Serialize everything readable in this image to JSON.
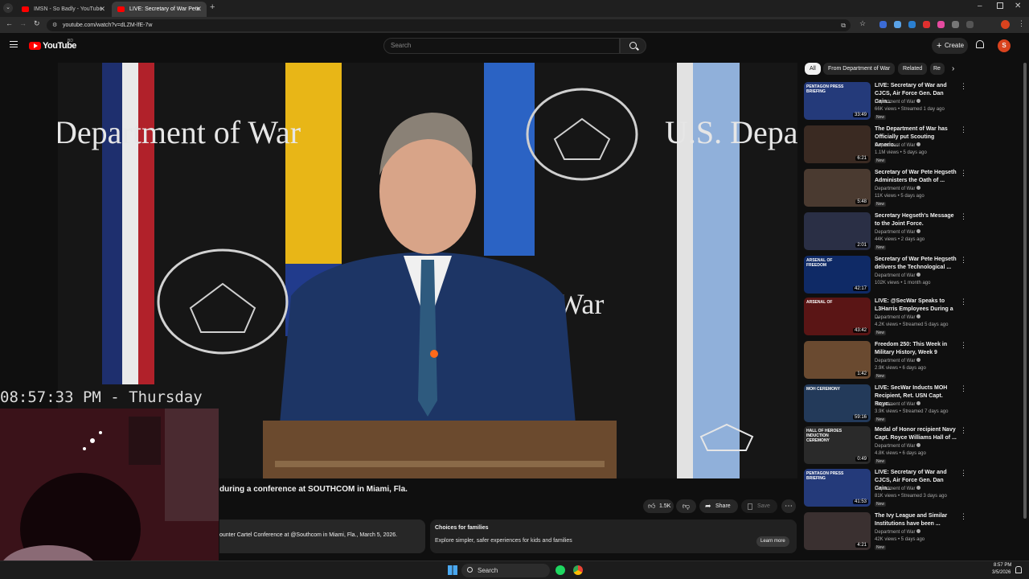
{
  "browser": {
    "tabs": [
      {
        "title": "IMSN - So Badly - YouTube",
        "active": false
      },
      {
        "title": "LIVE: Secretary of War Pete",
        "active": true
      }
    ],
    "url": "youtube.com/watch?v=dLZM-lfE-7w"
  },
  "youtube": {
    "logo_text": "YouTube",
    "country_badge": "BD",
    "search_placeholder": "Search",
    "create_label": "Create",
    "avatar_letter": "S"
  },
  "player": {
    "backdrop_text_left": "Department of War",
    "backdrop_text_right": "U.S. Department",
    "backdrop_text_mid": "nt of War"
  },
  "overlay": {
    "clock": "08:57:33 PM - Thursday"
  },
  "video": {
    "title_fragment": "during a conference at SOUTHCOM in Miami, Fla.",
    "likes": "1.5K",
    "share_label": "Share",
    "save_label": "Save",
    "description_fragment": "ounter Cartel Conference at @Southcom in Miami, Fla., March 5, 2026."
  },
  "promo": {
    "title": "Choices for families",
    "body": "Explore simpler, safer experiences for kids and families",
    "cta": "Learn more"
  },
  "chips": [
    "All",
    "From Department of War",
    "Related",
    "Re"
  ],
  "recommendations": [
    {
      "title": "LIVE: Secretary of War and CJCS, Air Force Gen. Dan Cain...",
      "channel": "Department of War",
      "meta": "66K views • Streamed 1 day ago",
      "badge": "New",
      "duration": "33:49"
    },
    {
      "title": "The Department of War has Officially put Scouting Americ...",
      "channel": "Department of War",
      "meta": "1.1M views • 5 days ago",
      "badge": "New",
      "duration": "6:21"
    },
    {
      "title": "Secretary of War Pete Hegseth Administers the Oath of ...",
      "channel": "Department of War",
      "meta": "11K views • 5 days ago",
      "badge": "New",
      "duration": "5:48"
    },
    {
      "title": "Secretary Hegseth's Message to the Joint Force.",
      "channel": "Department of War",
      "meta": "44K views • 2 days ago",
      "badge": "New",
      "duration": "2:01"
    },
    {
      "title": "Secretary of War Pete Hegseth delivers the Technological ...",
      "channel": "Department of War",
      "meta": "102K views • 1 month ago",
      "badge": "",
      "duration": "42:17"
    },
    {
      "title": "LIVE: @SecWar Speaks to L3Harris Employees During a ...",
      "channel": "Department of War",
      "meta": "4.2K views • Streamed 5 days ago",
      "badge": "New",
      "duration": "43:42"
    },
    {
      "title": "Freedom 250: This Week in Military History, Week 9",
      "channel": "Department of War",
      "meta": "2.9K views • 6 days ago",
      "badge": "New",
      "duration": "1:42"
    },
    {
      "title": "LIVE: SecWar Inducts MOH Recipient, Ret. USN Capt. Royc...",
      "channel": "Department of War",
      "meta": "3.9K views • Streamed 7 days ago",
      "badge": "New",
      "duration": "59:16"
    },
    {
      "title": "Medal of Honor recipient Navy Capt. Royce Williams Hall of ...",
      "channel": "Department of War",
      "meta": "4.8K views • 6 days ago",
      "badge": "New",
      "duration": "0:49"
    },
    {
      "title": "LIVE: Secretary of War and CJCS, Air Force Gen. Dan Cain...",
      "channel": "Department of War",
      "meta": "81K views • Streamed 3 days ago",
      "badge": "New",
      "duration": "41:53"
    },
    {
      "title": "The Ivy League and Similar Institutions have been ...",
      "channel": "Department of War",
      "meta": "42K views • 5 days ago",
      "badge": "New",
      "duration": "4:21"
    }
  ],
  "thumb_labels": [
    "PENTAGON PRESS BRIEFING",
    "",
    "",
    "",
    "ARSENAL OF FREEDOM",
    "ARSENAL OF",
    "",
    "MOH CEREMONY",
    "HALL OF HEROES INDUCTION CEREMONY",
    "PENTAGON PRESS BRIEFING",
    ""
  ],
  "taskbar": {
    "search_label": "Search",
    "time": "8:57 PM",
    "date": "3/5/2026"
  },
  "colors": {
    "yt_red": "#ff0000",
    "background": "#0f0f0f",
    "navy_suit": "#1d3565"
  }
}
